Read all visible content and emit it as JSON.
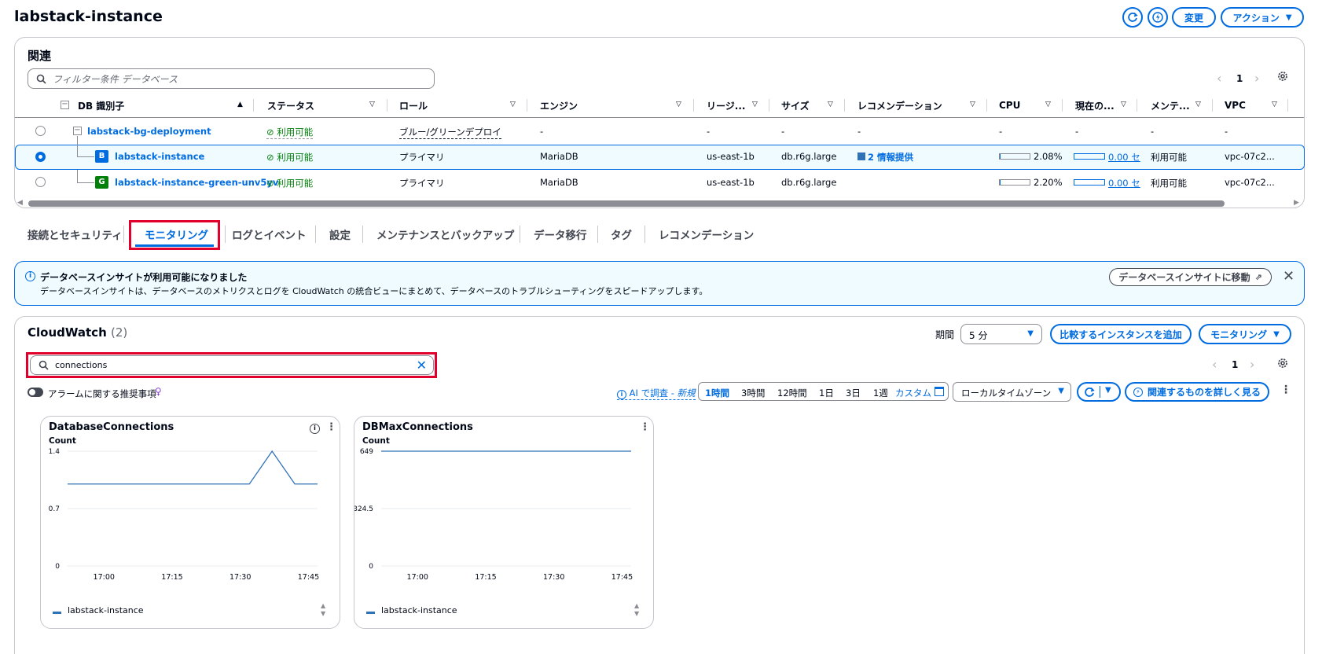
{
  "page": {
    "title": "labstack-instance"
  },
  "header_actions": {
    "modify_label": "変更",
    "actions_label": "アクション"
  },
  "related": {
    "heading": "関連",
    "filter_placeholder": "フィルター条件 データベース",
    "page": "1",
    "columns": [
      "DB 識別子",
      "ステータス",
      "ロール",
      "エンジン",
      "リージ...",
      "サイズ",
      "レコメンデーション",
      "CPU",
      "現在の...",
      "メンテ...",
      "VPC"
    ],
    "rows": [
      {
        "id": "labstack-bg-deployment",
        "status": "利用可能",
        "role": "ブルー/グリーンデプロイ",
        "engine": "-",
        "region": "-",
        "size": "-",
        "rec": "-",
        "cpu": "-",
        "current": "-",
        "maint": "-",
        "vpc": "-"
      },
      {
        "badge": "B",
        "id": "labstack-instance",
        "status": "利用可能",
        "role": "プライマリ",
        "engine": "MariaDB",
        "region": "us-east-1b",
        "size": "db.r6g.large",
        "rec": "2 情報提供",
        "cpu": "2.08%",
        "cpu_fraction": 0.0208,
        "current": "0.00 セ",
        "maint": "利用可能",
        "vpc": "vpc-07c2..."
      },
      {
        "badge": "G",
        "id": "labstack-instance-green-unv5yv",
        "status": "利用可能",
        "role": "プライマリ",
        "engine": "MariaDB",
        "region": "us-east-1b",
        "size": "db.r6g.large",
        "rec": "",
        "cpu": "2.20%",
        "cpu_fraction": 0.022,
        "current": "0.00 セ",
        "maint": "利用可能",
        "vpc": "vpc-07c2..."
      }
    ]
  },
  "tabs": [
    "接続とセキュリティ",
    "モニタリング",
    "ログとイベント",
    "設定",
    "メンテナンスとバックアップ",
    "データ移行",
    "タグ",
    "レコメンデーション"
  ],
  "active_tab": "モニタリング",
  "info_banner": {
    "title": "データベースインサイトが利用可能になりました",
    "body": "データベースインサイトは、データベースのメトリクスとログを CloudWatch の統合ビューにまとめて、データベースのトラブルシューティングをスピードアップします。",
    "button": "データベースインサイトに移動"
  },
  "cloudwatch": {
    "title": "CloudWatch",
    "count": "(2)",
    "period_label": "期間",
    "period_value": "5 分",
    "compare_button": "比較するインスタンスを追加",
    "monitoring_button": "モニタリング",
    "search_value": "connections",
    "page": "1",
    "alarm_toggle_label": "アラームに関する推奨事項",
    "ai_label": "AI で調査 - ",
    "ai_new": "新規",
    "time_ranges": [
      "1時間",
      "3時間",
      "12時間",
      "1日",
      "3日",
      "1週"
    ],
    "active_range": "1時間",
    "custom_label": "カスタム",
    "timezone": "ローカルタイムゾーン",
    "explore_button": "関連するものを詳しく見る"
  },
  "chart_data": [
    {
      "type": "line",
      "title": "DatabaseConnections",
      "ylabel": "Count",
      "ylim": [
        0,
        1.4
      ],
      "yticks": [
        "1.4",
        "0.7",
        "0"
      ],
      "x": [
        "16:52",
        "17:27",
        "17:32",
        "17:37",
        "17:42",
        "17:47"
      ],
      "xticks": [
        "17:00",
        "17:15",
        "17:30",
        "17:45"
      ],
      "series": [
        {
          "name": "labstack-instance",
          "values": [
            1,
            1,
            1,
            1.4,
            1,
            1
          ]
        }
      ]
    },
    {
      "type": "line",
      "title": "DBMaxConnections",
      "ylabel": "Count",
      "ylim": [
        0,
        649
      ],
      "yticks": [
        "649",
        "324.5",
        "0"
      ],
      "x": [
        "16:52",
        "17:47"
      ],
      "xticks": [
        "17:00",
        "17:15",
        "17:30",
        "17:45"
      ],
      "series": [
        {
          "name": "labstack-instance",
          "values": [
            649,
            649
          ]
        }
      ]
    }
  ],
  "colors": {
    "accent": "#006ce0",
    "success": "#037f0c",
    "highlight_box": "#e0002b",
    "series": "#2f72b8"
  }
}
